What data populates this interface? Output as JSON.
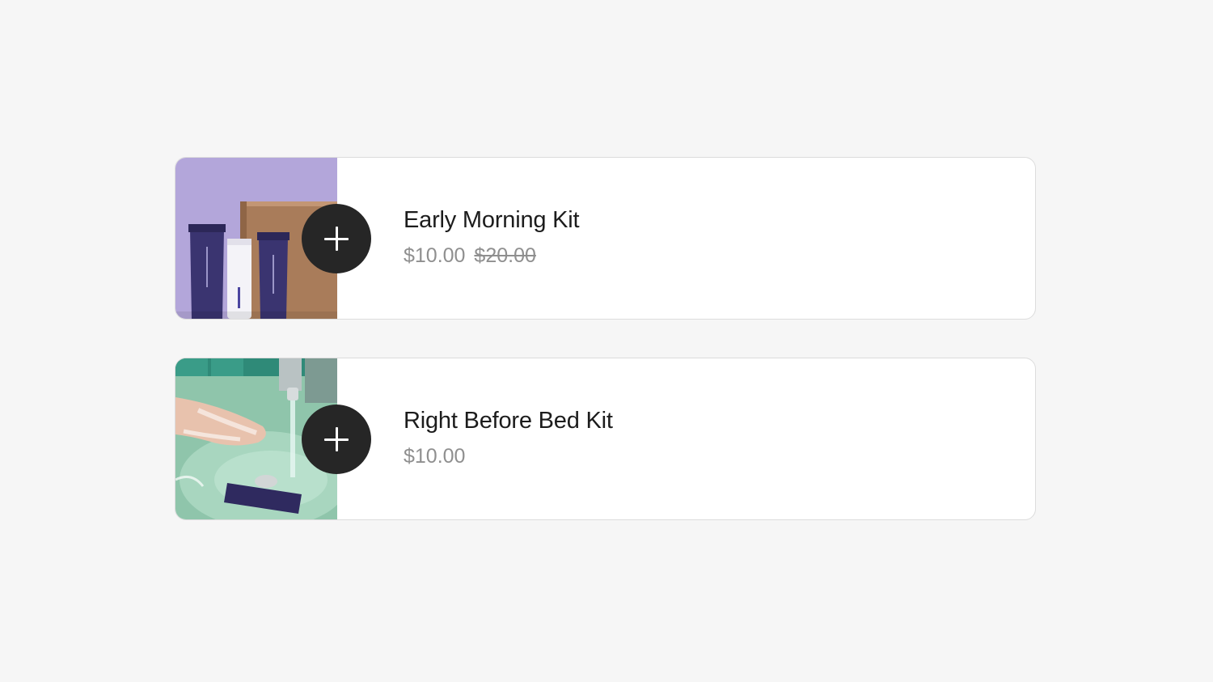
{
  "products": [
    {
      "name": "Early Morning Kit",
      "price": "$10.00",
      "original_price": "$20.00",
      "image": "skincare-kit-box",
      "add_icon": "plus-icon"
    },
    {
      "name": "Right Before Bed Kit",
      "price": "$10.00",
      "original_price": null,
      "image": "washing-hands-sink",
      "add_icon": "plus-icon"
    }
  ],
  "colors": {
    "background": "#f6f6f6",
    "card": "#ffffff",
    "card_border": "#dcdcdc",
    "button": "#262626",
    "title_text": "#1c1c1c",
    "price_text": "#8f8f8f",
    "thumb1_bg": "#b3a6da",
    "thumb2_bg": "#8fc5ab"
  }
}
